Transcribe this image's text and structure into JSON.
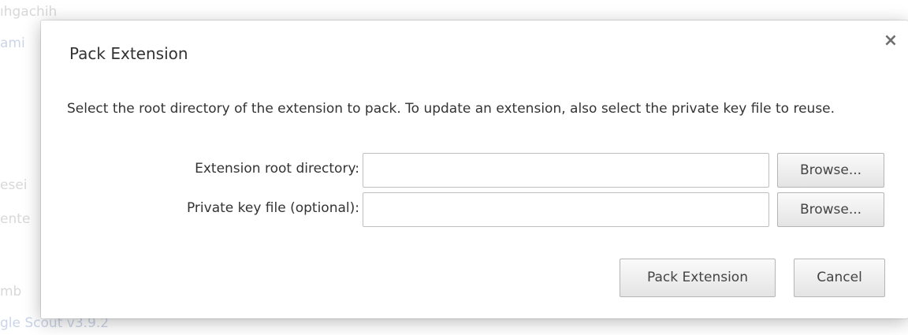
{
  "background": {
    "fragments": [
      "ıhgachih",
      "ami",
      "esei",
      "ente",
      "mb",
      "gle Scout v3.9.2"
    ]
  },
  "dialog": {
    "title": "Pack Extension",
    "close_glyph": "×",
    "description": "Select the root directory of the extension to pack. To update an extension, also select the private key file to reuse.",
    "fields": [
      {
        "label": "Extension root directory:",
        "value": "",
        "browse_label": "Browse..."
      },
      {
        "label": "Private key file (optional):",
        "value": "",
        "browse_label": "Browse..."
      }
    ],
    "buttons": {
      "pack_label": "Pack Extension",
      "cancel_label": "Cancel"
    }
  },
  "colors": {
    "link_faded": "#aebfdc",
    "text": "#333333",
    "button_border": "#b5b5b5"
  },
  "icons": {
    "close": "close-icon"
  }
}
